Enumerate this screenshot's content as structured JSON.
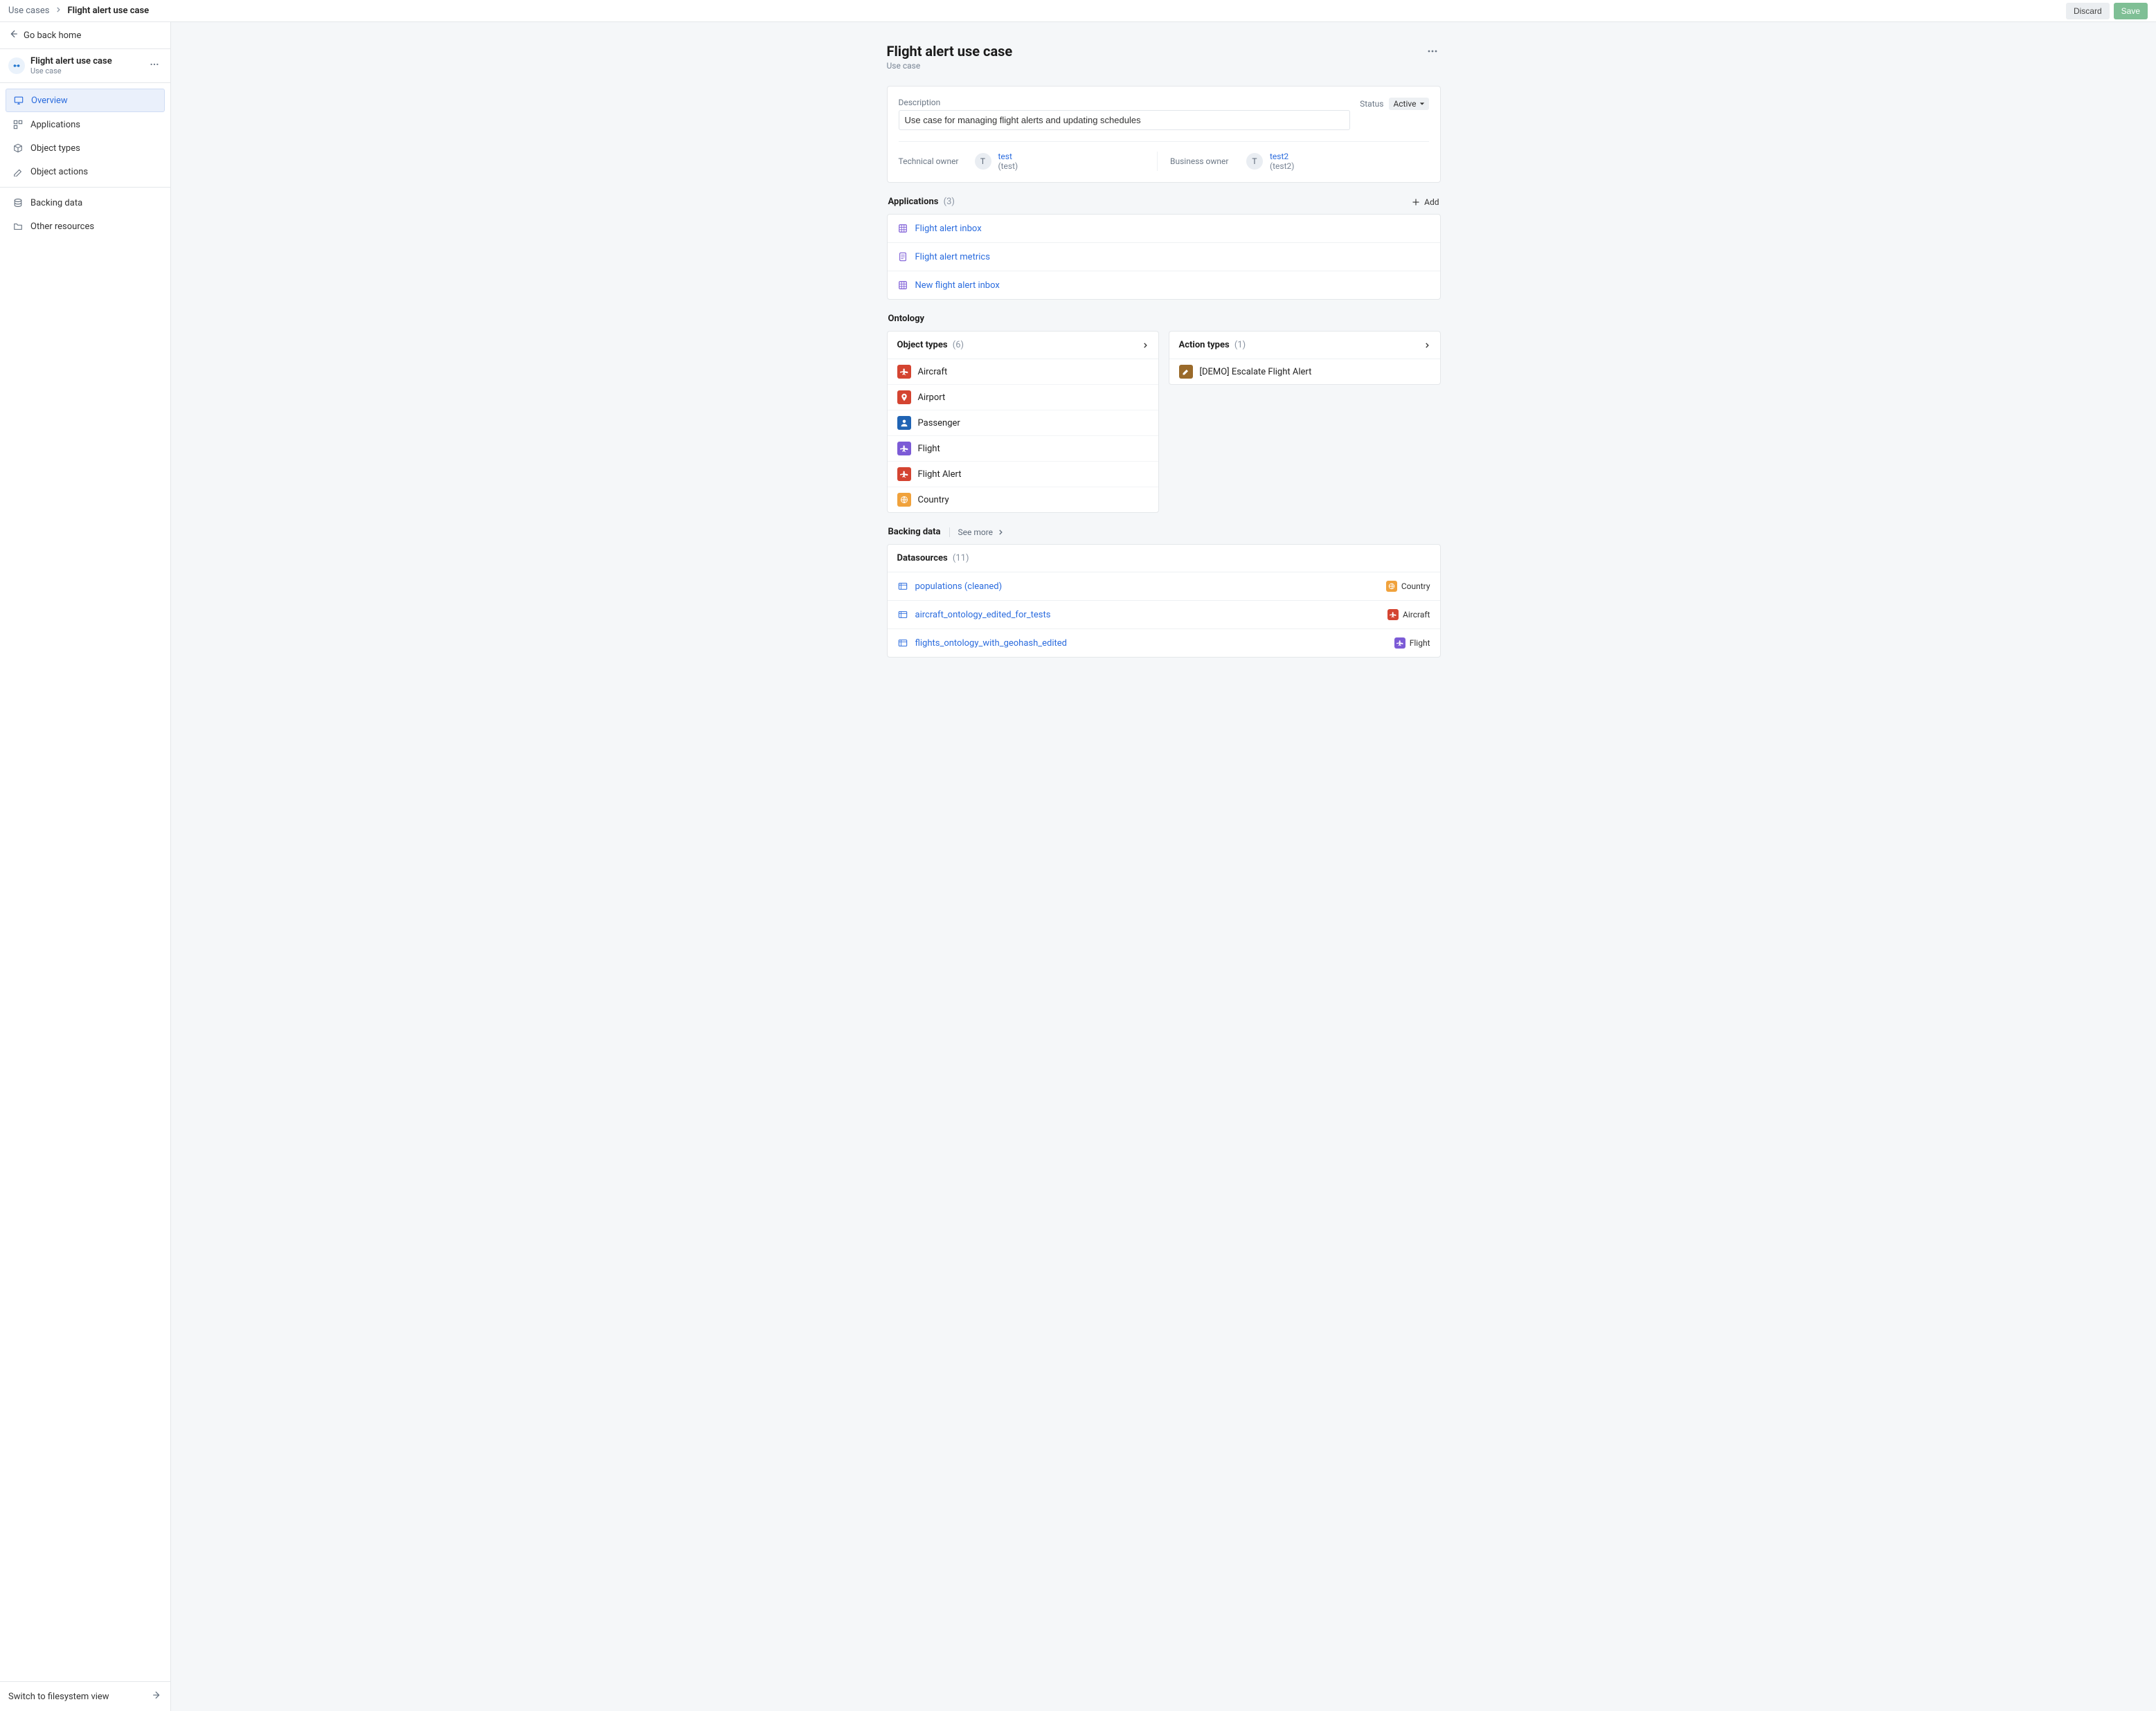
{
  "breadcrumbs": {
    "root": "Use cases",
    "current": "Flight alert use case"
  },
  "topbar": {
    "discard": "Discard",
    "save": "Save"
  },
  "sidebar": {
    "goBack": "Go back home",
    "project": {
      "title": "Flight alert use case",
      "subtitle": "Use case"
    },
    "items": {
      "overview": "Overview",
      "applications": "Applications",
      "objectTypes": "Object types",
      "objectActions": "Object actions",
      "backingData": "Backing data",
      "otherResources": "Other resources"
    },
    "switchView": "Switch to filesystem view"
  },
  "page": {
    "title": "Flight alert use case",
    "subtitle": "Use case",
    "description": {
      "label": "Description",
      "value": "Use case for managing flight alerts and updating schedules"
    },
    "status": {
      "label": "Status",
      "value": "Active"
    },
    "owners": {
      "technical": {
        "label": "Technical owner",
        "avatar": "T",
        "name": "test",
        "handle": "(test)"
      },
      "business": {
        "label": "Business owner",
        "avatar": "T",
        "name": "test2",
        "handle": "(test2)"
      }
    }
  },
  "applications": {
    "title": "Applications",
    "count": "(3)",
    "add": "Add",
    "items": [
      {
        "name": "Flight alert inbox"
      },
      {
        "name": "Flight alert metrics"
      },
      {
        "name": "New flight alert inbox"
      }
    ]
  },
  "ontology": {
    "title": "Ontology",
    "objectTypes": {
      "title": "Object types",
      "count": "(6)",
      "items": [
        {
          "name": "Aircraft",
          "color": "bg-red"
        },
        {
          "name": "Airport",
          "color": "bg-red"
        },
        {
          "name": "Passenger",
          "color": "bg-blue"
        },
        {
          "name": "Flight",
          "color": "bg-purple"
        },
        {
          "name": "Flight Alert",
          "color": "bg-red"
        },
        {
          "name": "Country",
          "color": "bg-orange"
        }
      ]
    },
    "actionTypes": {
      "title": "Action types",
      "count": "(1)",
      "items": [
        {
          "name": "[DEMO] Escalate Flight Alert",
          "color": "bg-brown"
        }
      ]
    }
  },
  "backingData": {
    "title": "Backing data",
    "seeMore": "See more",
    "datasources": {
      "title": "Datasources",
      "count": "(11)",
      "items": [
        {
          "name": "populations (cleaned)",
          "tag": "Country",
          "tagColor": "bg-orange"
        },
        {
          "name": "aircraft_ontology_edited_for_tests",
          "tag": "Aircraft",
          "tagColor": "bg-red"
        },
        {
          "name": "flights_ontology_with_geohash_edited",
          "tag": "Flight",
          "tagColor": "bg-purple"
        }
      ]
    }
  }
}
